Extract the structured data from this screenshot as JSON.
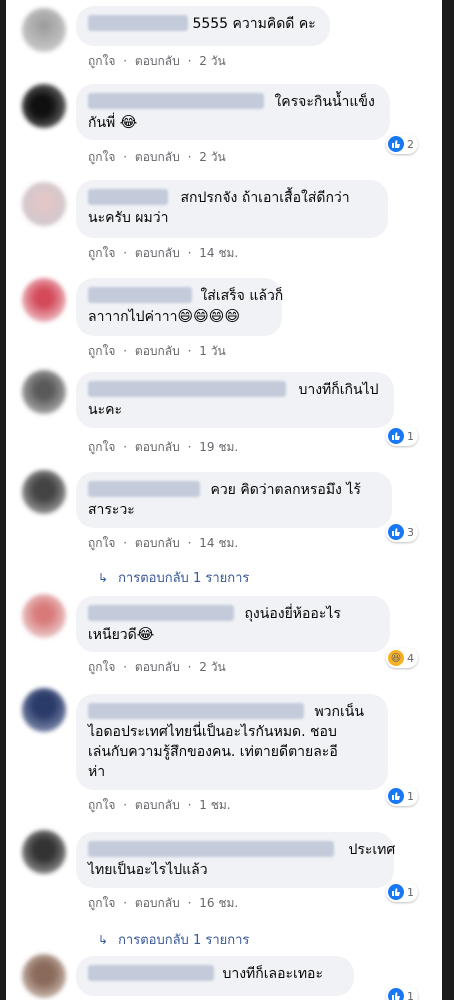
{
  "actions": {
    "like": "ถูกใจ",
    "sep": "·",
    "reply": "ตอบกลับ"
  },
  "comments": [
    {
      "lines": [
        "5555 ความคิดดี คะ"
      ],
      "time": "2 วัน"
    },
    {
      "lines": [
        "ใครจะกินน้ำแข็ง",
        "กันพี่ "
      ],
      "emoji": "😂",
      "time": "2 วัน",
      "reaction_count": "2",
      "reaction": "like"
    },
    {
      "lines": [
        "สกปรกจัง ถ้าเอาเสื้อใส่ดีกว่า",
        "นะครับ ผมว่า"
      ],
      "time": "14 ชม."
    },
    {
      "lines": [
        "ใส่เสร็จ แล้วก็",
        "ลาาากไปค่าาา"
      ],
      "emoji": "😄😄😄😄",
      "time": "1 วัน"
    },
    {
      "lines": [
        "บางทีก็เกินไป",
        "นะคะ"
      ],
      "time": "19 ชม.",
      "reaction_count": "1",
      "reaction": "like"
    },
    {
      "lines": [
        "ควย คิดว่าตลกหรอมึง ไร้",
        "สาระวะ"
      ],
      "time": "14 ชม.",
      "reaction_count": "3",
      "reaction": "like"
    },
    {
      "lines": [
        "ถุงน่องยี่ห้ออะไร",
        "เหนียวดี"
      ],
      "emoji": "😂",
      "time": "2 วัน",
      "reaction_count": "4",
      "reaction": "haha"
    },
    {
      "lines": [
        "พวกเน็น",
        "ไอดอประเทศไทยนี่เป็นอะไรกันหมด. ชอบ",
        "เล่นกับความรู้สึกของคน. เท่ตายดีตายละอี",
        "ห่า"
      ],
      "time": "1 ชม.",
      "reaction_count": "1",
      "reaction": "like"
    },
    {
      "lines": [
        "ประเทศ",
        "ไทยเป็นอะไรไปแล้ว"
      ],
      "time": "16 ชม.",
      "reaction_count": "1",
      "reaction": "like"
    },
    {
      "lines": [
        "บางทีก็เลอะเทอะ"
      ],
      "reaction_count": "1",
      "reaction": "like"
    }
  ],
  "reply_links": [
    {
      "label": "การตอบกลับ 1 รายการ"
    },
    {
      "label": "การตอบกลับ 1 รายการ"
    }
  ],
  "colors": {
    "like": "#1877f2",
    "link": "#385898",
    "bubble": "#f0f2f5",
    "meta": "#65676b"
  }
}
